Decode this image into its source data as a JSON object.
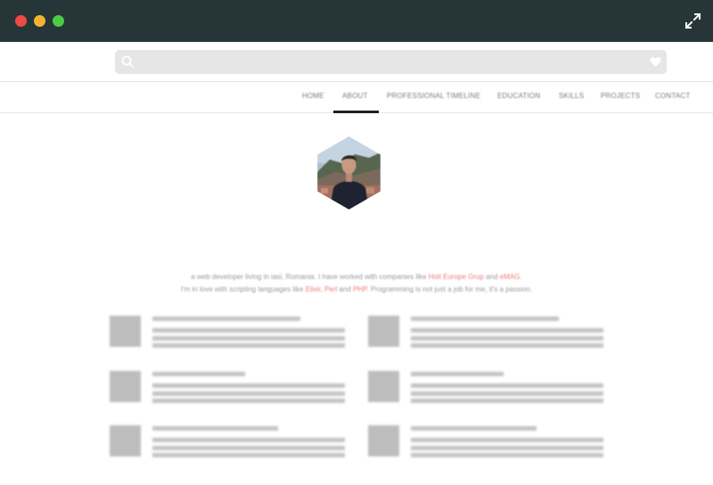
{
  "window": {
    "controls": [
      "close",
      "minimize",
      "zoom"
    ],
    "fullscreen_icon": "expand-arrows-icon"
  },
  "search": {
    "placeholder": "",
    "value": "",
    "icon": "search-icon",
    "favorite_icon": "heart-icon"
  },
  "nav": {
    "items": [
      {
        "label": "HOME"
      },
      {
        "label": "ABOUT",
        "active": true
      },
      {
        "label": "PROFESSIONAL TIMELINE"
      },
      {
        "label": "EDUCATION"
      },
      {
        "label": "SKILLS"
      },
      {
        "label": "PROJECTS"
      },
      {
        "label": "CONTACT"
      }
    ]
  },
  "profile": {
    "photo": "hexagon-profile-photo"
  },
  "bio": {
    "line1_a": "a web developer living in iasi, Romania. I have worked with companies like ",
    "link1": "Hoit Europe Grup",
    "line1_b": " and ",
    "link2": "eMAG",
    "line1_c": ".",
    "line2_a": "I'm in love with scripting languages like ",
    "link3": "Elixir, Perl",
    "line2_b": " and ",
    "link4": "PHP",
    "line2_c": ". Programming is not just a job for me, it's a passion."
  },
  "colors": {
    "titlebar": "#263538",
    "close": "#ee4b43",
    "minimize": "#f6b332",
    "zoom": "#4ccc45",
    "link_accent": "#ef7b7b"
  }
}
